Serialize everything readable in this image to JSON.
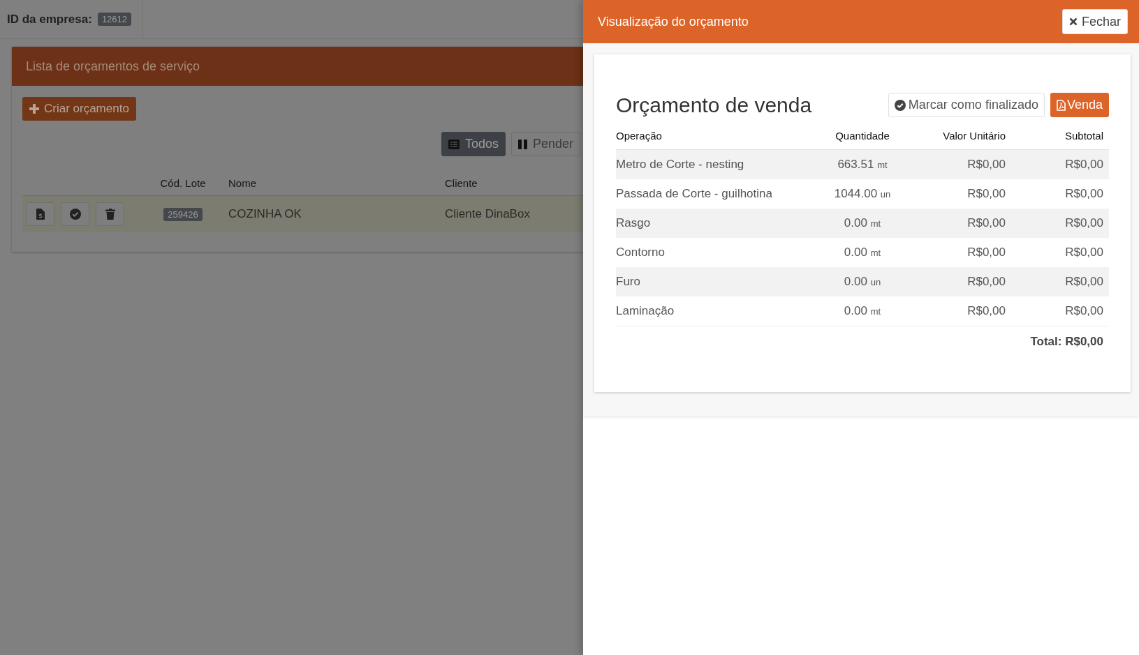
{
  "company": {
    "label": "ID da empresa:",
    "id": "12612"
  },
  "list_panel": {
    "title": "Lista de orçamentos de serviço",
    "create_button": "Criar orçamento",
    "filters": [
      {
        "label": "Todos",
        "selected": true
      },
      {
        "label": "Pender",
        "selected": false
      }
    ],
    "table": {
      "columns": [
        "Cód. Lote",
        "Nome",
        "Cliente"
      ],
      "rows": [
        {
          "lot": "259426",
          "name": "COZINHA OK",
          "client": "Cliente DinaBox"
        }
      ]
    }
  },
  "drawer": {
    "title": "Visualização do orçamento",
    "close_button": "Fechar",
    "heading": "Orçamento de venda",
    "finalize_button": "Marcar como finalizado",
    "sale_button": "Venda",
    "columns": [
      "Operação",
      "Quantidade",
      "Valor Unitário",
      "Subtotal"
    ],
    "rows": [
      {
        "operation": "Metro de Corte - nesting",
        "quantity": "663.51",
        "unit": "mt",
        "unit_value": "R$0,00",
        "subtotal": "R$0,00"
      },
      {
        "operation": "Passada de Corte - guilhotina",
        "quantity": "1044.00",
        "unit": "un",
        "unit_value": "R$0,00",
        "subtotal": "R$0,00"
      },
      {
        "operation": "Rasgo",
        "quantity": "0.00",
        "unit": "mt",
        "unit_value": "R$0,00",
        "subtotal": "R$0,00"
      },
      {
        "operation": "Contorno",
        "quantity": "0.00",
        "unit": "mt",
        "unit_value": "R$0,00",
        "subtotal": "R$0,00"
      },
      {
        "operation": "Furo",
        "quantity": "0.00",
        "unit": "un",
        "unit_value": "R$0,00",
        "subtotal": "R$0,00"
      },
      {
        "operation": "Laminação",
        "quantity": "0.00",
        "unit": "mt",
        "unit_value": "R$0,00",
        "subtotal": "R$0,00"
      }
    ],
    "total": "Total: R$0,00"
  }
}
